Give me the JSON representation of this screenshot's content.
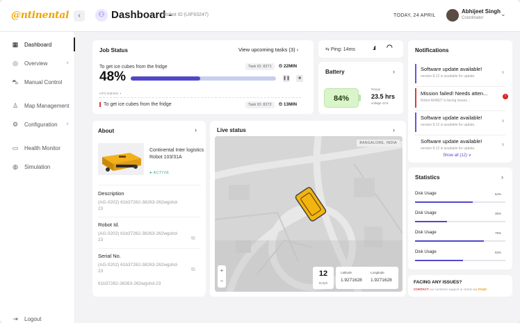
{
  "header": {
    "logo": "@ntinental",
    "title": "Dashboard -",
    "robot_id": "Robot ID (UIF93247)",
    "date": "TODAY, 24 APRIL",
    "user_name": "Abhijeet Singh",
    "user_role": "Coordinator"
  },
  "sidebar": {
    "items": [
      {
        "label": "Dashboard",
        "icon": "grid-icon"
      },
      {
        "label": "Overview",
        "icon": "eye-icon"
      },
      {
        "label": "Manual Control",
        "icon": "car-icon"
      },
      {
        "label": "Map Management",
        "icon": "user-map-icon"
      },
      {
        "label": "Configuration",
        "icon": "gear-icon"
      },
      {
        "label": "Health Monitor",
        "icon": "monitor-icon"
      },
      {
        "label": "Simulation",
        "icon": "globe-icon"
      }
    ],
    "logout": "Logout"
  },
  "job_status": {
    "title": "Job Status",
    "link": "View upcoming tasks (3)",
    "current_task": "To get ice cubes from the fridge",
    "current_task_id": "Task ID: 8271",
    "current_time": "22MIN",
    "percent_label": "48%",
    "progress": 0.48,
    "upcoming_label": "UPCOMING •",
    "next_task": "To get ice cubes from the fridge",
    "next_task_id": "Task ID: 8272",
    "next_time": "13MIN"
  },
  "ping": {
    "label": "Ping: 14ms"
  },
  "battery": {
    "title": "Battery",
    "level": "84%",
    "range_label": "Range",
    "range_value": "23.5 hrs",
    "voltage": "voltage 13.5"
  },
  "notifications": {
    "title": "Notifications",
    "items": [
      {
        "title": "Software update available!",
        "sub": "version 8.12 is available for update."
      },
      {
        "title": "Mission failed! Needs atten...",
        "sub": "Robot A04827 is facing issues..."
      },
      {
        "title": "Software update available!",
        "sub": "version 8.12 is available for update."
      },
      {
        "title": "Software update available!",
        "sub": "version 8.12 is available for update."
      }
    ],
    "badge": "!",
    "show_all": "Show all (12) ∨"
  },
  "about": {
    "title": "About",
    "robot_name": "Continental Inter logistics Robot 103/31A",
    "status": "● ACTIVE",
    "description_label": "Description",
    "description_value": "(AG-0202) 61b37262-38263-262wgshd-23",
    "robot_id_label": "Robot Id.",
    "robot_id_value": "(AG-0202) 61b37262-38263-262wgshd-23",
    "serial_label": "Serial No.",
    "serial_value": "(AG-0202) 61b37262-38263-262wgshd-23",
    "serial_value_2": "61b37262-38263-262wgshd-23"
  },
  "live": {
    "title": "Live status",
    "location": "BANGALORE, INDIA",
    "speed": "12",
    "speed_unit": "km/ph",
    "lat_label": "Latitude",
    "lat_value": "1.9271628",
    "lng_label": "Longitude",
    "lng_value": "1.9271628",
    "zoom_in": "+",
    "zoom_out": "−"
  },
  "statistics": {
    "title": "Statistics",
    "items": [
      {
        "label": "Disk Usage",
        "pct": "64%",
        "value": 0.64
      },
      {
        "label": "Disk Usage",
        "pct": "35%",
        "value": 0.35
      },
      {
        "label": "Disk Usage",
        "pct": "76%",
        "value": 0.76
      },
      {
        "label": "Disk Usage",
        "pct": "53%",
        "value": 0.53
      }
    ]
  },
  "issues": {
    "title": "FACING ANY ISSUES?",
    "contact": "CONTACT",
    "middle": " our customer support or check our ",
    "faqs": "FAQS"
  },
  "colors": {
    "accent": "#5147c8",
    "brand": "#f0a400",
    "success": "#2eb07d",
    "danger": "#d63a3a"
  }
}
